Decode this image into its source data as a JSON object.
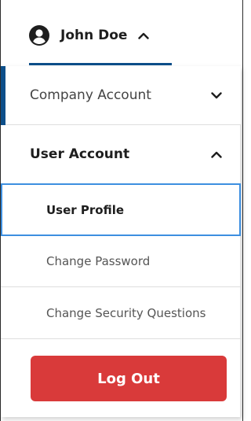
{
  "header": {
    "user_name": "John Doe",
    "user_icon": "user-circle-icon",
    "toggle_icon": "chevron-up-icon"
  },
  "menu": {
    "sections": [
      {
        "label": "Company Account",
        "expanded": false,
        "icon": "chevron-down-icon"
      },
      {
        "label": "User Account",
        "expanded": true,
        "icon": "chevron-up-icon"
      }
    ],
    "user_account_items": [
      {
        "label": "User Profile",
        "active": true
      },
      {
        "label": "Change Password",
        "active": false
      },
      {
        "label": "Change Security Questions",
        "active": false
      }
    ],
    "logout_label": "Log Out"
  },
  "colors": {
    "accent": "#0d4f8a",
    "focus_outline": "#3d8fe0",
    "logout_bg": "#d93a3a",
    "text_dark": "#1e1e1e",
    "text_muted": "#555555"
  }
}
